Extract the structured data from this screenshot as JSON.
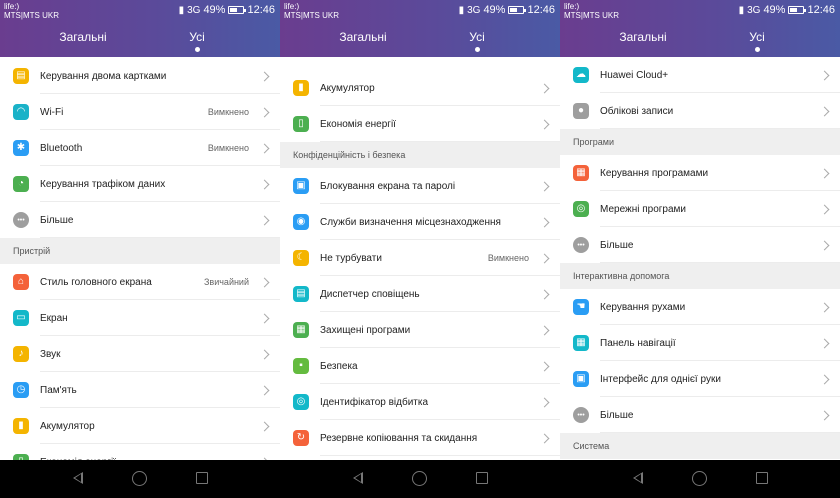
{
  "status": {
    "carrier_top": "life:)",
    "carrier_bottom": "MTS|MTS UKR",
    "battery": "49%",
    "time": "12:46",
    "signal_label": "3G",
    "battery_level": 0.49
  },
  "tabs": {
    "general": "Загальні",
    "all": "Усі",
    "active": "all"
  },
  "panel1": {
    "rows_top": [
      {
        "label": "Керування двома картками",
        "icon": "dual-sim-icon",
        "color": "#f4b400",
        "value": ""
      },
      {
        "label": "Wi-Fi",
        "icon": "wifi-icon",
        "color": "#1ab2c8",
        "value": "Вимкнено"
      },
      {
        "label": "Bluetooth",
        "icon": "bluetooth-icon",
        "color": "#2a9df4",
        "value": "Вимкнено"
      },
      {
        "label": "Керування трафіком даних",
        "icon": "data-traffic-icon",
        "color": "#4caf50",
        "value": ""
      },
      {
        "label": "Більше",
        "icon": "more-icon",
        "color": "#9e9e9e",
        "value": ""
      }
    ],
    "section": "Пристрій",
    "rows_bottom": [
      {
        "label": "Стиль головного екрана",
        "icon": "home-icon",
        "color": "#f4623a",
        "value": "Звичайний"
      },
      {
        "label": "Екран",
        "icon": "display-icon",
        "color": "#13b8c9",
        "value": ""
      },
      {
        "label": "Звук",
        "icon": "sound-icon",
        "color": "#f4b400",
        "value": ""
      },
      {
        "label": "Пам'ять",
        "icon": "storage-icon",
        "color": "#2a9df4",
        "value": ""
      },
      {
        "label": "Акумулятор",
        "icon": "battery-icon",
        "color": "#f4b400",
        "value": ""
      },
      {
        "label": "Економія енергії",
        "icon": "power-saving-icon",
        "color": "#4caf50",
        "value": ""
      }
    ]
  },
  "panel2": {
    "rows_top": [
      {
        "label": "Акумулятор",
        "icon": "battery-icon",
        "color": "#f4b400",
        "value": ""
      },
      {
        "label": "Економія енергії",
        "icon": "power-saving-icon",
        "color": "#4caf50",
        "value": ""
      }
    ],
    "section": "Конфіденційність і безпека",
    "rows_bottom": [
      {
        "label": "Блокування екрана та паролі",
        "icon": "lock-screen-icon",
        "color": "#2a9df4",
        "value": ""
      },
      {
        "label": "Служби визначення місцезнаходження",
        "icon": "location-icon",
        "color": "#2a9df4",
        "value": ""
      },
      {
        "label": "Не турбувати",
        "icon": "moon-icon",
        "color": "#f4b400",
        "value": "Вимкнено"
      },
      {
        "label": "Диспетчер сповіщень",
        "icon": "notification-icon",
        "color": "#13b8c9",
        "value": ""
      },
      {
        "label": "Захищені програми",
        "icon": "protected-apps-icon",
        "color": "#4caf50",
        "value": ""
      },
      {
        "label": "Безпека",
        "icon": "security-lock-icon",
        "color": "#64bb3f",
        "value": ""
      },
      {
        "label": "Ідентифікатор відбитка",
        "icon": "fingerprint-icon",
        "color": "#13b8c9",
        "value": ""
      },
      {
        "label": "Резервне копіювання та скидання",
        "icon": "backup-icon",
        "color": "#f4623a",
        "value": ""
      }
    ]
  },
  "panel3": {
    "rows_top": [
      {
        "label": "Huawei Cloud+",
        "icon": "cloud-icon",
        "color": "#13b8c9",
        "value": ""
      },
      {
        "label": "Облікові записи",
        "icon": "account-icon",
        "color": "#9e9e9e",
        "value": ""
      }
    ],
    "section1": "Програми",
    "rows_mid": [
      {
        "label": "Керування програмами",
        "icon": "apps-grid-icon",
        "color": "#f4623a",
        "value": ""
      },
      {
        "label": "Мережні програми",
        "icon": "network-apps-icon",
        "color": "#4caf50",
        "value": ""
      },
      {
        "label": "Більше",
        "icon": "more-icon",
        "color": "#9e9e9e",
        "value": ""
      }
    ],
    "section2": "Інтерактивна допомога",
    "rows_bottom": [
      {
        "label": "Керування рухами",
        "icon": "gesture-icon",
        "color": "#2a9df4",
        "value": ""
      },
      {
        "label": "Панель навігації",
        "icon": "navigation-bar-icon",
        "color": "#13b8c9",
        "value": ""
      },
      {
        "label": "Інтерфейс для однієї руки",
        "icon": "one-hand-icon",
        "color": "#2a9df4",
        "value": ""
      },
      {
        "label": "Більше",
        "icon": "more-icon",
        "color": "#9e9e9e",
        "value": ""
      }
    ],
    "section3": "Система"
  }
}
